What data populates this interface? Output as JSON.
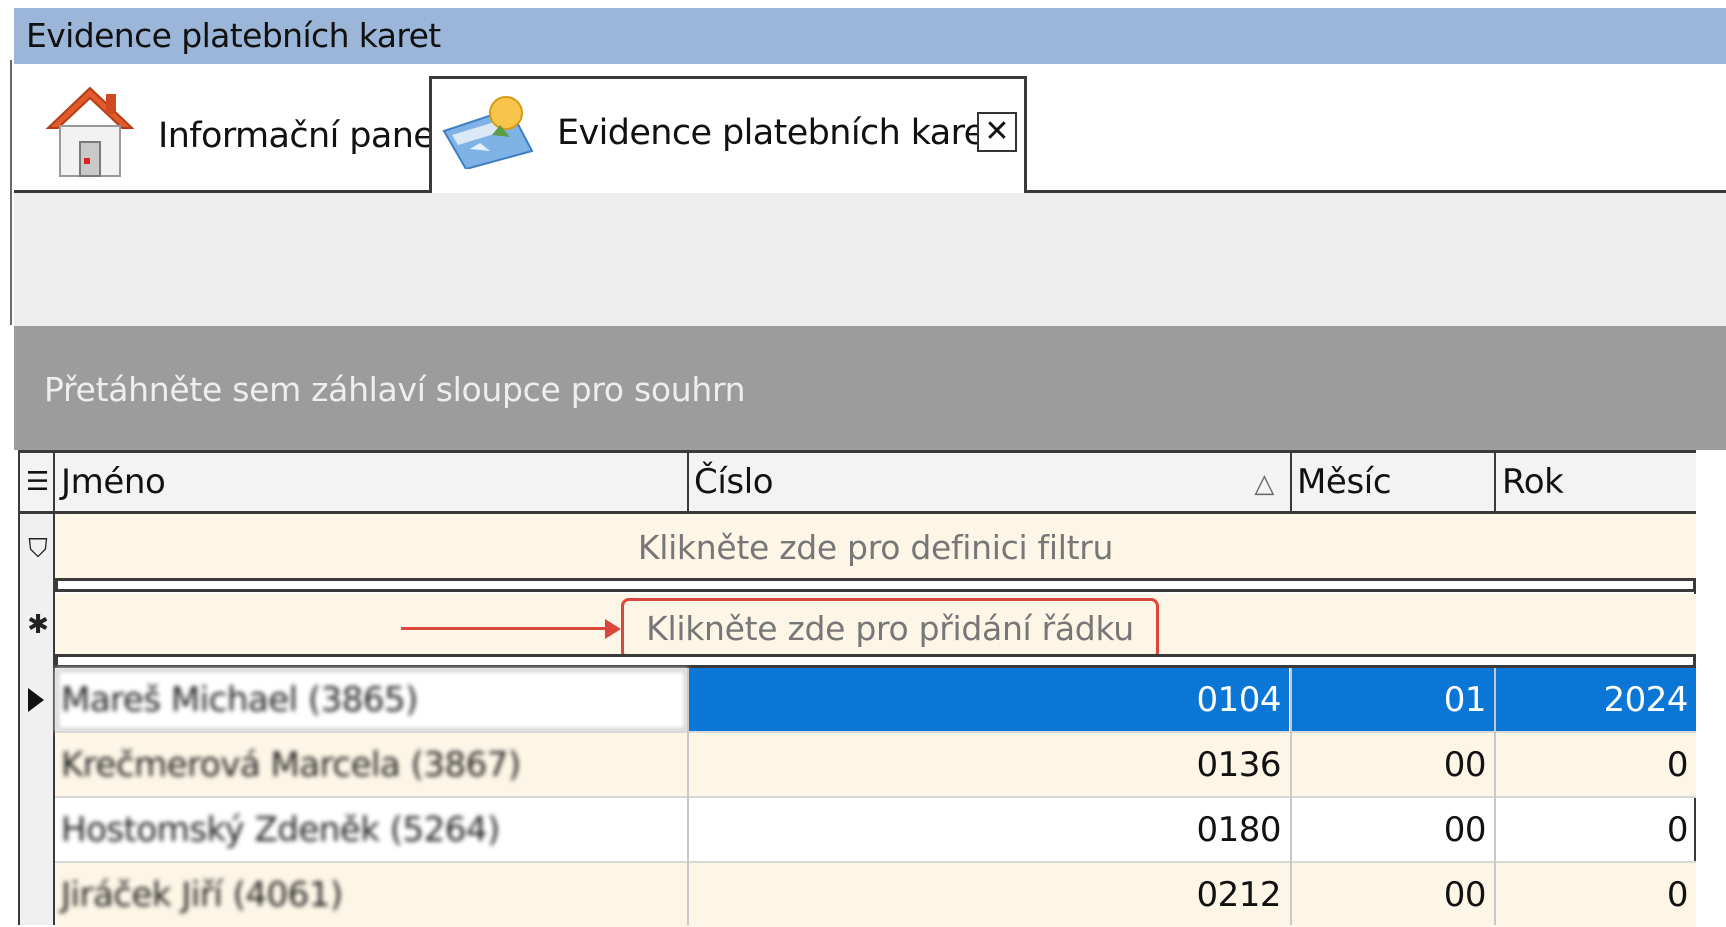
{
  "window": {
    "title": "Evidence platebních karet"
  },
  "tabs": [
    {
      "label": "Informační panel",
      "icon": "home-icon",
      "active": false
    },
    {
      "label": "Evidence platebních karet",
      "icon": "payment-card-icon",
      "active": true,
      "close_label": "✕"
    }
  ],
  "grid": {
    "group_by_hint": "Přetáhněte sem záhlaví sloupce pro souhrn",
    "columns": [
      {
        "label": "Jméno"
      },
      {
        "label": "Číslo",
        "sort": "ascending",
        "sort_glyph": "△"
      },
      {
        "label": "Měsíc"
      },
      {
        "label": "Rok"
      }
    ],
    "filter_row_text": "Klikněte zde pro definici filtru",
    "add_row_text": "Klikněte zde pro přidání řádku",
    "rows": [
      {
        "name": "Mareš Michael (3865)",
        "cislo": "0104",
        "mesic": "01",
        "rok": "2024",
        "selected": true
      },
      {
        "name": "Krečmerová Marcela (3867)",
        "cislo": "0136",
        "mesic": "00",
        "rok": "0",
        "selected": false
      },
      {
        "name": "Hostomský Zdeněk (5264)",
        "cislo": "0180",
        "mesic": "00",
        "rok": "0",
        "selected": false
      },
      {
        "name": "Jiráček Jiří (4061)",
        "cislo": "0212",
        "mesic": "00",
        "rok": "0",
        "selected": false
      }
    ],
    "indicator_glyphs": {
      "column_chooser": "☰",
      "filter": "⛉",
      "new_row": "✱"
    }
  },
  "colors": {
    "title_bar": "#9bb6d8",
    "selection": "#0a76d6",
    "annotation": "#d9473d",
    "row_alt": "#fdf6e7"
  }
}
